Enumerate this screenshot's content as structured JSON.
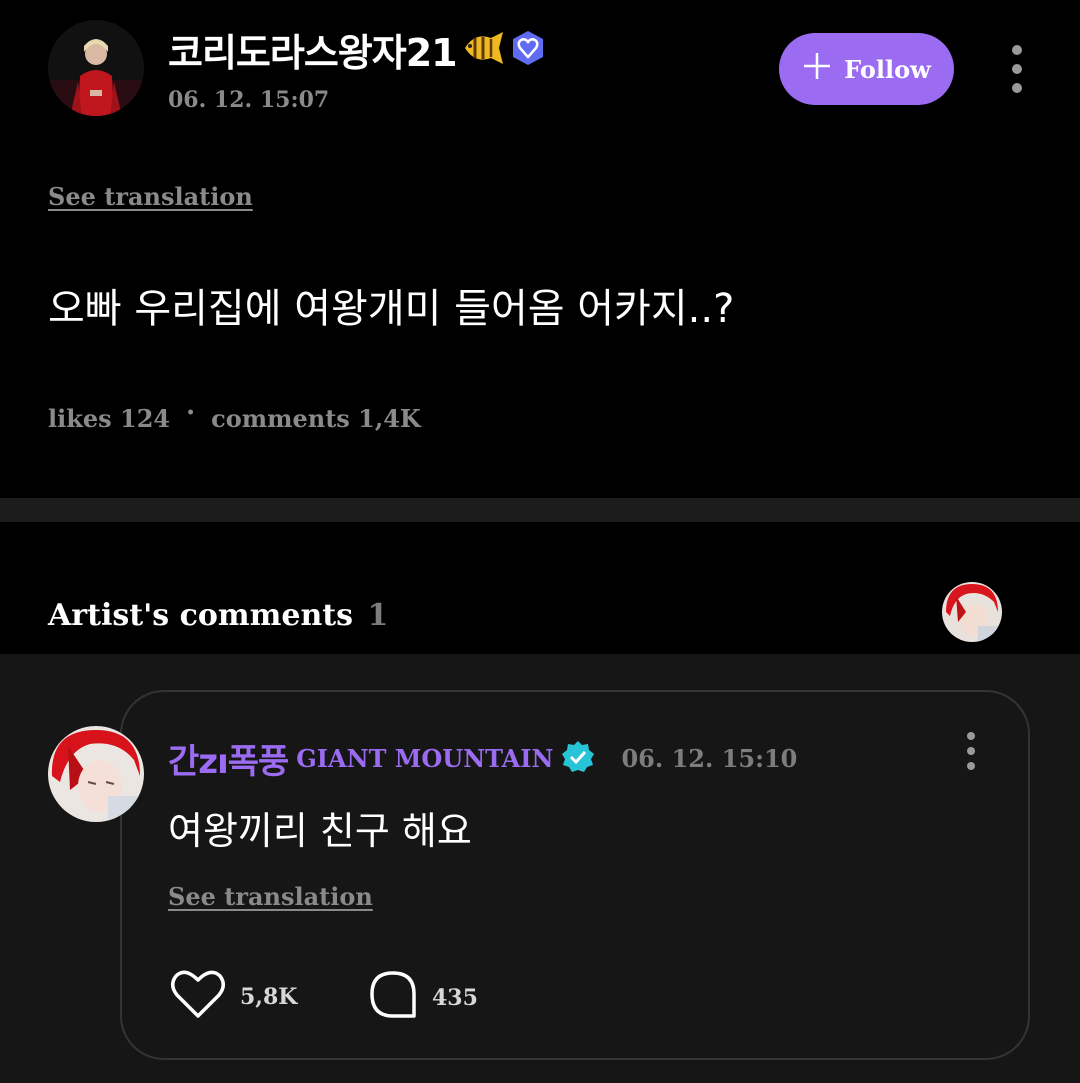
{
  "post": {
    "author": {
      "name": "코리도라스왕자21",
      "badge_icon": "fish-icon",
      "verified_icon": "heart-badge-icon"
    },
    "timestamp": "06. 12. 15:07",
    "follow_label": "Follow",
    "see_translation": "See translation",
    "text": "오빠 우리집에 여왕개미 들어옴 어카지..?",
    "likes_label": "likes",
    "likes_count": "124",
    "comments_label": "comments",
    "comments_count": "1,4K"
  },
  "artist_comments": {
    "title": "Artist's comments",
    "count": "1"
  },
  "comment": {
    "author_name": "간zı폭풍",
    "author_group": "GIANT MOUNTAIN",
    "verified_icon": "verified-icon",
    "timestamp": "06. 12. 15:10",
    "text": "여왕끼리 친구 해요",
    "see_translation": "See translation",
    "likes_count": "5,8K",
    "replies_count": "435"
  },
  "colors": {
    "accent": "#9b6cf2",
    "background": "#000000",
    "card_background": "#161616",
    "muted_text": "#8a8a8a",
    "verified_teal": "#27c3d6"
  }
}
